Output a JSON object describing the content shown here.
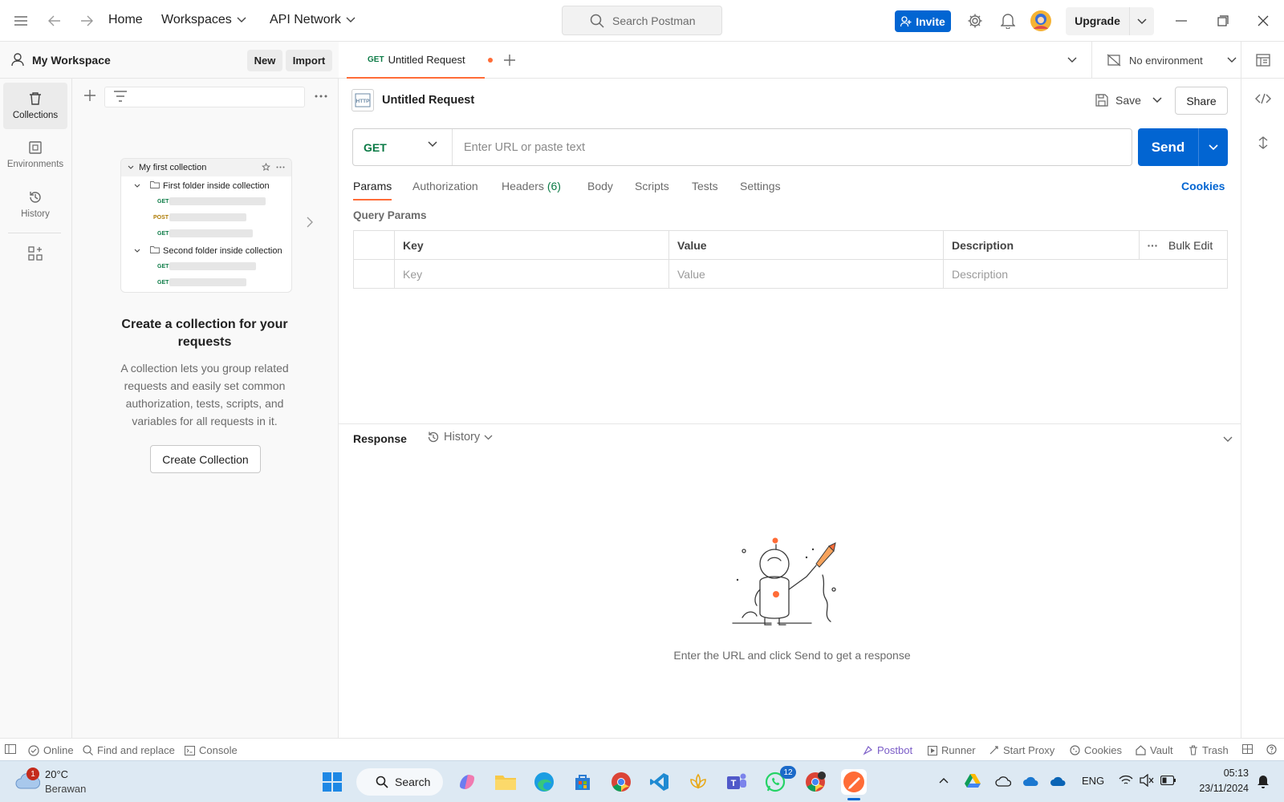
{
  "topbar": {
    "home": "Home",
    "workspaces": "Workspaces",
    "api_network": "API Network",
    "search_placeholder": "Search Postman",
    "invite": "Invite",
    "upgrade": "Upgrade"
  },
  "workspace": {
    "name": "My Workspace",
    "new_label": "New",
    "import_label": "Import"
  },
  "rail": {
    "items": [
      {
        "label": "Collections",
        "icon": "trash-bin-icon"
      },
      {
        "label": "Environments",
        "icon": "environment-icon"
      },
      {
        "label": "History",
        "icon": "history-icon"
      }
    ]
  },
  "collection_preview": {
    "title": "My first collection",
    "folder1": "First folder inside collection",
    "folder2": "Second folder inside collection",
    "requests": [
      {
        "method": "GET",
        "color": "#0a7a45"
      },
      {
        "method": "POST",
        "color": "#ad7a03"
      },
      {
        "method": "GET",
        "color": "#0a7a45"
      },
      {
        "method": "GET",
        "color": "#0a7a45"
      },
      {
        "method": "GET",
        "color": "#0a7a45"
      }
    ]
  },
  "empty_state": {
    "title": "Create a collection for your requests",
    "description": "A collection lets you group related requests and easily set common authorization, tests, scripts, and variables for all requests in it.",
    "button": "Create Collection"
  },
  "tab": {
    "method": "GET",
    "title": "Untitled Request"
  },
  "environment": {
    "label": "No environment"
  },
  "request": {
    "title": "Untitled Request",
    "save": "Save",
    "share": "Share",
    "method": "GET",
    "url_placeholder": "Enter URL or paste text",
    "send": "Send",
    "tabs": {
      "params": "Params",
      "authorization": "Authorization",
      "headers": "Headers",
      "headers_count": "(6)",
      "body": "Body",
      "scripts": "Scripts",
      "tests": "Tests",
      "settings": "Settings"
    },
    "cookies": "Cookies",
    "query_params_title": "Query Params",
    "table": {
      "key": "Key",
      "value": "Value",
      "description": "Description",
      "bulk_edit": "Bulk Edit",
      "key_ph": "Key",
      "value_ph": "Value",
      "description_ph": "Description"
    }
  },
  "response": {
    "label": "Response",
    "history": "History",
    "message": "Enter the URL and click Send to get a response"
  },
  "statusbar": {
    "online": "Online",
    "find_replace": "Find and replace",
    "console": "Console",
    "postbot": "Postbot",
    "runner": "Runner",
    "start_proxy": "Start Proxy",
    "cookies": "Cookies",
    "vault": "Vault",
    "trash": "Trash"
  },
  "taskbar": {
    "weather_temp": "20°C",
    "weather_desc": "Berawan",
    "weather_badge": "1",
    "search": "Search",
    "whatsapp_badge": "12",
    "lang": "ENG",
    "time": "05:13",
    "date": "23/11/2024"
  },
  "colors": {
    "accent": "#ff6c37",
    "primary": "#0265d2",
    "get_method": "#0a7a45"
  }
}
